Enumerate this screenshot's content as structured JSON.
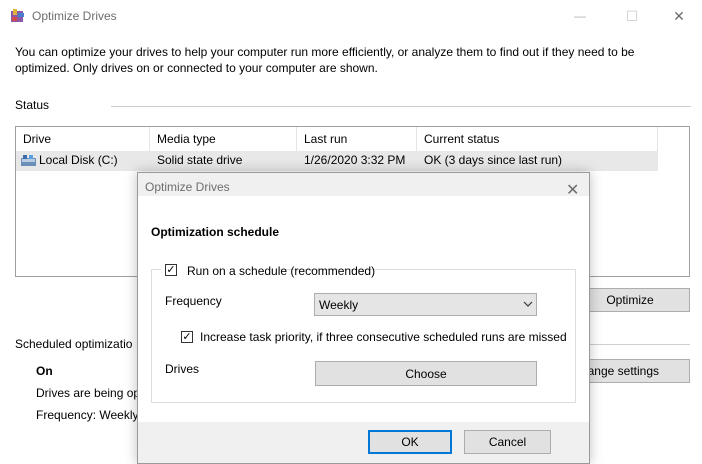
{
  "window": {
    "title": "Optimize Drives",
    "minimize": "—",
    "maximize": "☐",
    "close": "✕"
  },
  "description": "You can optimize your drives to help your computer run more efficiently, or analyze them to find out if they need to be optimized. Only drives on or connected to your computer are shown.",
  "status": {
    "label": "Status",
    "columns": [
      "Drive",
      "Media type",
      "Last run",
      "Current status"
    ],
    "rows": [
      {
        "drive": "Local Disk (C:)",
        "media": "Solid state drive",
        "last_run": "1/26/2020 3:32 PM",
        "status": "OK (3 days since last run)"
      }
    ]
  },
  "buttons": {
    "optimize": "Optimize",
    "change_settings": "ange settings"
  },
  "scheduled": {
    "label": "Scheduled optimizatio",
    "state": "On",
    "line1": "Drives are being op",
    "line2": "Frequency: Weekly"
  },
  "dialog": {
    "title": "Optimize Drives",
    "close": "✕",
    "heading": "Optimization schedule",
    "run_schedule_label": "Run on a schedule (recommended)",
    "run_schedule_checked": "✓",
    "frequency_label": "Frequency",
    "frequency_value": "Weekly",
    "priority_label": "Increase task priority, if three consecutive scheduled runs are missed",
    "priority_checked": "✓",
    "drives_label": "Drives",
    "choose_button": "Choose",
    "ok_button": "OK",
    "cancel_button": "Cancel"
  }
}
